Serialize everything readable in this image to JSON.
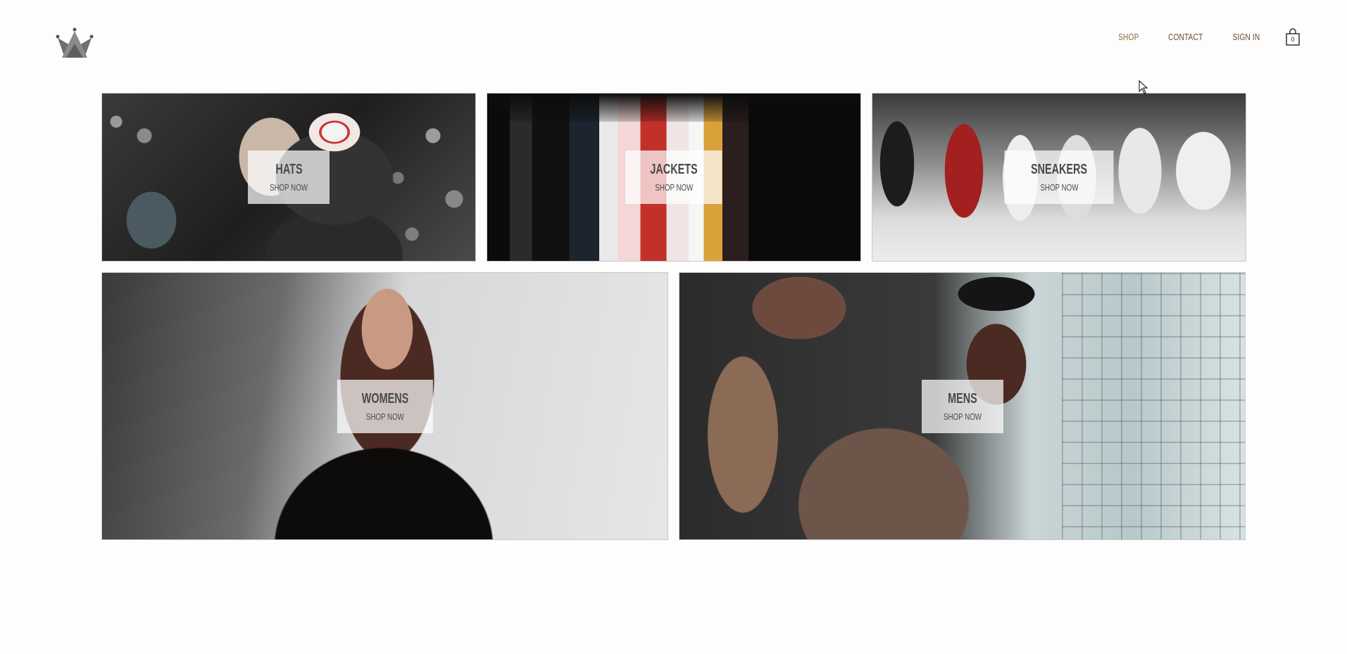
{
  "header": {
    "logo_icon": "crown-logo-icon",
    "nav": {
      "shop_label": "SHOP",
      "contact_label": "CONTACT",
      "signin_label": "SIGN IN"
    },
    "cart": {
      "icon": "shopping-bag-icon",
      "count": "0"
    }
  },
  "directory": {
    "sections": [
      {
        "title": "HATS",
        "subtitle": "SHOP NOW"
      },
      {
        "title": "JACKETS",
        "subtitle": "SHOP NOW"
      },
      {
        "title": "SNEAKERS",
        "subtitle": "SHOP NOW"
      },
      {
        "title": "WOMENS",
        "subtitle": "SHOP NOW"
      },
      {
        "title": "MENS",
        "subtitle": "SHOP NOW"
      }
    ]
  },
  "colors": {
    "nav_text": "#6b4a3a",
    "title_text": "#4a4a4a",
    "content_box_bg": "rgba(255,255,255,0.72)",
    "page_bg": "#fdfdfd"
  }
}
